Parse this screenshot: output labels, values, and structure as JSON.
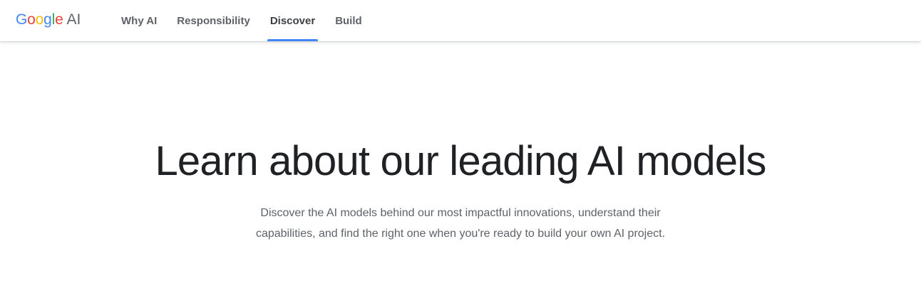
{
  "brand": {
    "letters": [
      {
        "char": "G",
        "color": "#4285f4"
      },
      {
        "char": "o",
        "color": "#ea4335"
      },
      {
        "char": "o",
        "color": "#fbbc05"
      },
      {
        "char": "g",
        "color": "#4285f4"
      },
      {
        "char": "l",
        "color": "#34a853"
      },
      {
        "char": "e",
        "color": "#ea4335"
      }
    ],
    "suffix": "AI"
  },
  "nav": {
    "items": [
      {
        "label": "Why AI",
        "active": false
      },
      {
        "label": "Responsibility",
        "active": false
      },
      {
        "label": "Discover",
        "active": true
      },
      {
        "label": "Build",
        "active": false
      }
    ],
    "active_indicator_color": "#4285f4"
  },
  "hero": {
    "title": "Learn about our leading AI models",
    "description": "Discover the AI models behind our most impactful innovations, understand their capabilities, and find the right one when you're ready to build your own AI project."
  }
}
